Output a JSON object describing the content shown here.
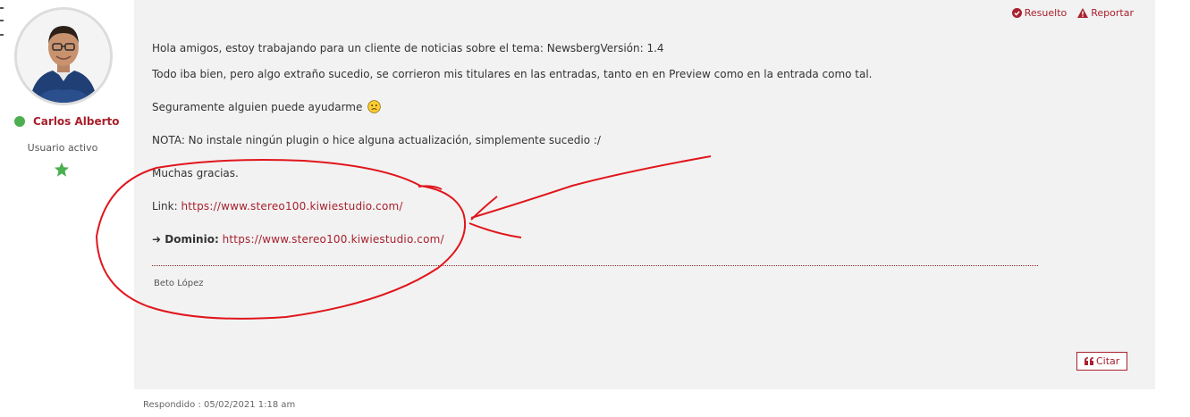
{
  "author": {
    "name": "Carlos Alberto",
    "role": "Usuario activo",
    "status_color": "#4caf50",
    "rank_icon": "star-icon"
  },
  "post": {
    "actions": {
      "resolved_label": "Resuelto",
      "resolved_icon": "check-circle-icon",
      "report_label": "Reportar",
      "report_icon": "warning-icon"
    },
    "paragraphs": {
      "p1": "Hola amigos, estoy trabajando para un cliente de noticias sobre el tema: NewsbergVersión: 1.4",
      "p2": "Todo iba bien, pero algo extraño sucedio, se corrieron mis titulares en las entradas, tanto en en Preview como en la entrada como tal.",
      "p3": "Seguramente alguien puede ayudarme",
      "p4": "NOTA: No instale ningún plugin o hice alguna actualización, simplemente sucedio :/",
      "p5": "Muchas gracias."
    },
    "emoji": "frowning-face-icon",
    "link": {
      "label": "Link:",
      "url": "https://www.stereo100.kiwiestudio.com/"
    },
    "domain": {
      "label": "➜ Dominio:",
      "url": "https://www.stereo100.kiwiestudio.com/"
    },
    "signature": "Beto López",
    "quote_label": "Citar",
    "quote_icon": "quote-icon"
  },
  "reply_meta": "Respondido : 05/02/2021 1:18 am",
  "colors": {
    "accent": "#a8212e",
    "panel_bg": "#f2f2f2",
    "annotation_red": "#e0161c"
  }
}
